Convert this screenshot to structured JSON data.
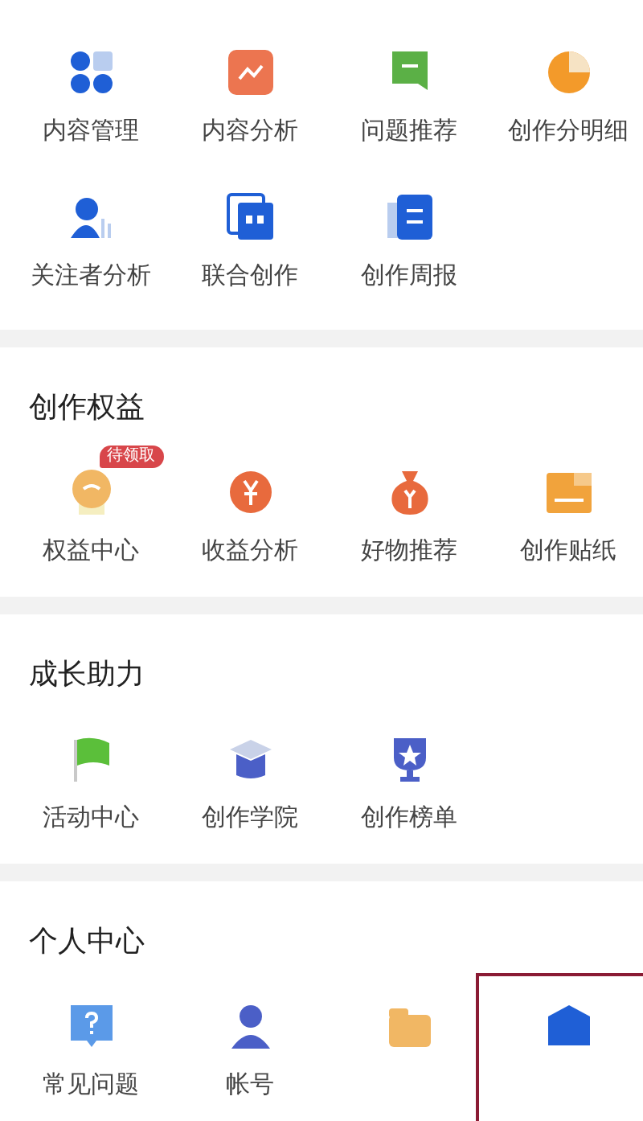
{
  "sections": [
    {
      "items": [
        {
          "label": "内容管理"
        },
        {
          "label": "内容分析"
        },
        {
          "label": "问题推荐"
        },
        {
          "label": "创作分明细"
        },
        {
          "label": "关注者分析"
        },
        {
          "label": "联合创作"
        },
        {
          "label": "创作周报"
        }
      ]
    },
    {
      "title": "创作权益",
      "items": [
        {
          "label": "权益中心",
          "badge": "待领取"
        },
        {
          "label": "收益分析"
        },
        {
          "label": "好物推荐"
        },
        {
          "label": "创作贴纸"
        }
      ]
    },
    {
      "title": "成长助力",
      "items": [
        {
          "label": "活动中心"
        },
        {
          "label": "创作学院"
        },
        {
          "label": "创作榜单"
        }
      ]
    },
    {
      "title": "个人中心",
      "items": [
        {
          "kind": "labeled",
          "label": "常见问题"
        },
        {
          "kind": "labeled",
          "label": "帐号"
        },
        {
          "kind": "icon"
        },
        {
          "kind": "icon"
        }
      ]
    }
  ]
}
